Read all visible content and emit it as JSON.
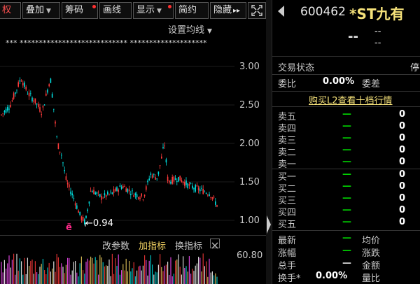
{
  "toolbar": {
    "buttons": [
      {
        "label": "权",
        "active": true
      },
      {
        "label": "叠加",
        "caret": true
      },
      {
        "label": "筹码",
        "dot": true
      },
      {
        "label": "画线"
      },
      {
        "label": "显示",
        "caret": true,
        "dot": true
      },
      {
        "label": "简约"
      },
      {
        "label": "隐藏",
        "arrows": "▸▸"
      }
    ],
    "expand_icon": "expand-icon"
  },
  "chart": {
    "ma_setting": "设置均线",
    "masked_legend": "***  ****************************  ********************",
    "y_axis": [
      "3.00",
      "2.50",
      "2.00",
      "1.50",
      "1.00"
    ],
    "low_marker": "←0.94",
    "indicator_buttons": [
      "改参数",
      "加指标",
      "换指标"
    ],
    "indicator_value": "60.80"
  },
  "chart_data": {
    "type": "line",
    "ylim": [
      0.85,
      3.2
    ],
    "low_label": "0.94"
  },
  "quote": {
    "code": "600462",
    "name": "*ST九有",
    "price": "--",
    "change": "--",
    "change_pct": "--",
    "trade_status_label": "交易状态",
    "trade_status_value": "停",
    "weibi_label": "委比",
    "weibi_value": "0.00%",
    "weicha_label": "委差",
    "buy_l2": "购买L2查看十档行情",
    "sell_levels": [
      {
        "label": "卖五",
        "dash": "—",
        "value": "0"
      },
      {
        "label": "卖四",
        "dash": "—",
        "value": "0"
      },
      {
        "label": "卖三",
        "dash": "—",
        "value": "0"
      },
      {
        "label": "卖二",
        "dash": "—",
        "value": "0"
      },
      {
        "label": "卖一",
        "dash": "—",
        "value": "0"
      }
    ],
    "buy_levels": [
      {
        "label": "买一",
        "dash": "—",
        "value": "0"
      },
      {
        "label": "买二",
        "dash": "—",
        "value": "0"
      },
      {
        "label": "买三",
        "dash": "—",
        "value": "0"
      },
      {
        "label": "买四",
        "dash": "—",
        "value": "0"
      },
      {
        "label": "买五",
        "dash": "—",
        "value": "0"
      }
    ],
    "stats": [
      {
        "l1": "最新",
        "d1": "—",
        "l2": "均价"
      },
      {
        "l1": "涨幅",
        "d1": "—",
        "l2": "涨跌"
      },
      {
        "l1": "总手",
        "d1": "—",
        "l2": "金额"
      },
      {
        "l1": "换手*",
        "d1": "0.00%",
        "l2": "量比"
      }
    ]
  }
}
